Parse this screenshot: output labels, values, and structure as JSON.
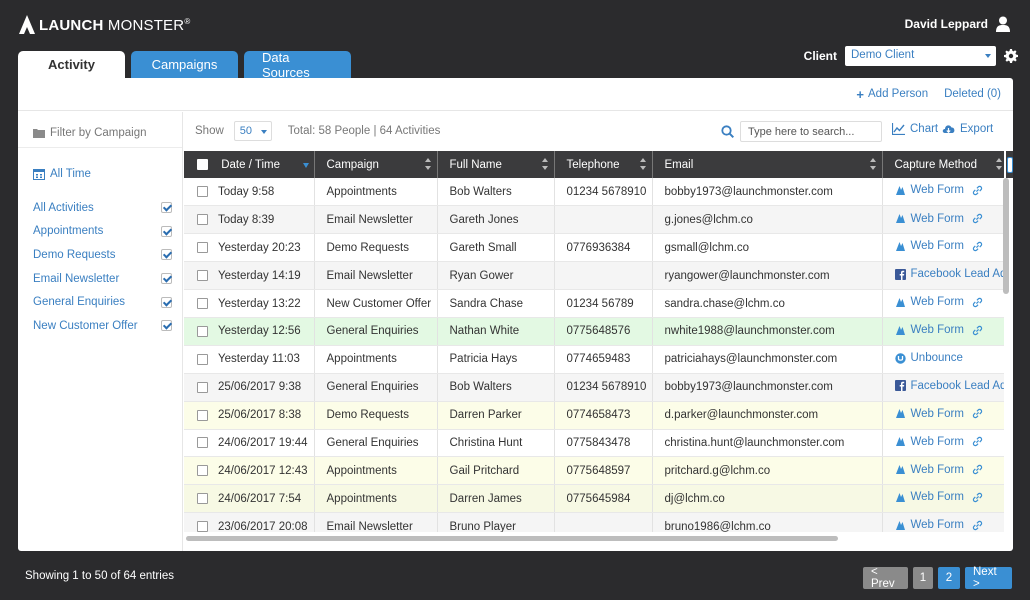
{
  "app": {
    "brand_bold": "LAUNCH",
    "brand_rest": " MONSTER",
    "trademark": "®"
  },
  "user": {
    "name": "David Leppard"
  },
  "client": {
    "label": "Client",
    "selected": "Demo Client"
  },
  "tabs": [
    {
      "label": "Activity",
      "active": true
    },
    {
      "label": "Campaigns",
      "active": false
    },
    {
      "label": "Data Sources",
      "active": false
    }
  ],
  "topbar": {
    "add_person": "Add Person",
    "deleted": "Deleted (0)"
  },
  "sidebar": {
    "filter_title": "Filter by Campaign",
    "time_filter": "All Time",
    "campaigns": [
      {
        "label": "All Activities",
        "checked": true
      },
      {
        "label": "Appointments",
        "checked": true
      },
      {
        "label": "Demo Requests",
        "checked": true
      },
      {
        "label": "Email Newsletter",
        "checked": true
      },
      {
        "label": "General Enquiries",
        "checked": true
      },
      {
        "label": "New Customer Offer",
        "checked": true
      }
    ]
  },
  "toolbar": {
    "show_label": "Show",
    "show_value": "50",
    "total": "Total: 58 People | 64 Activities",
    "search_placeholder": "Type here to search...",
    "chart": "Chart",
    "export": "Export"
  },
  "table": {
    "columns": [
      "Date / Time",
      "Campaign",
      "Full Name",
      "Telephone",
      "Email",
      "Capture Method"
    ],
    "rows": [
      {
        "date": "Today 9:58",
        "campaign": "Appointments",
        "name": "Bob Walters",
        "phone": "01234 5678910",
        "email": "bobby1973@launchmonster.com",
        "method": "Web Form",
        "method_icon": "webform",
        "style": "even"
      },
      {
        "date": "Today 8:39",
        "campaign": "Email Newsletter",
        "name": "Gareth Jones",
        "phone": "",
        "email": "g.jones@lchm.co",
        "method": "Web Form",
        "method_icon": "webform",
        "style": "odd"
      },
      {
        "date": "Yesterday 20:23",
        "campaign": "Demo Requests",
        "name": "Gareth Small",
        "phone": "0776936384",
        "email": "gsmall@lchm.co",
        "method": "Web Form",
        "method_icon": "webform",
        "style": "even"
      },
      {
        "date": "Yesterday 14:19",
        "campaign": "Email Newsletter",
        "name": "Ryan Gower",
        "phone": "",
        "email": "ryangower@launchmonster.com",
        "method": "Facebook Lead Ad",
        "method_icon": "facebook",
        "style": "odd"
      },
      {
        "date": "Yesterday 13:22",
        "campaign": "New Customer Offer",
        "name": "Sandra Chase",
        "phone": "01234 56789",
        "email": "sandra.chase@lchm.co",
        "method": "Web Form",
        "method_icon": "webform",
        "style": "even"
      },
      {
        "date": "Yesterday 12:56",
        "campaign": "General Enquiries",
        "name": "Nathan White",
        "phone": "0775648576",
        "email": "nwhite1988@launchmonster.com",
        "method": "Web Form",
        "method_icon": "webform",
        "style": "hl"
      },
      {
        "date": "Yesterday 11:03",
        "campaign": "Appointments",
        "name": "Patricia Hays",
        "phone": "0774659483",
        "email": "patriciahays@launchmonster.com",
        "method": "Unbounce",
        "method_icon": "unbounce",
        "style": "even"
      },
      {
        "date": "25/06/2017 9:38",
        "campaign": "General Enquiries",
        "name": "Bob Walters",
        "phone": "01234 5678910",
        "email": "bobby1973@launchmonster.com",
        "method": "Facebook Lead Ad",
        "method_icon": "facebook",
        "style": "odd"
      },
      {
        "date": "25/06/2017 8:38",
        "campaign": "Demo Requests",
        "name": "Darren Parker",
        "phone": "0774658473",
        "email": "d.parker@launchmonster.com",
        "method": "Web Form",
        "method_icon": "webform",
        "style": "yl"
      },
      {
        "date": "24/06/2017 19:44",
        "campaign": "General Enquiries",
        "name": "Christina Hunt",
        "phone": "0775843478",
        "email": "christina.hunt@launchmonster.com",
        "method": "Web Form",
        "method_icon": "webform",
        "style": "even"
      },
      {
        "date": "24/06/2017 12:43",
        "campaign": "Appointments",
        "name": "Gail Pritchard",
        "phone": "0775648597",
        "email": "pritchard.g@lchm.co",
        "method": "Web Form",
        "method_icon": "webform",
        "style": "yl"
      },
      {
        "date": "24/06/2017 7:54",
        "campaign": "Appointments",
        "name": "Darren James",
        "phone": "0775645984",
        "email": "dj@lchm.co",
        "method": "Web Form",
        "method_icon": "webform",
        "style": "yl"
      },
      {
        "date": "23/06/2017 20:08",
        "campaign": "Email Newsletter",
        "name": "Bruno Player",
        "phone": "",
        "email": "bruno1986@lchm.co",
        "method": "Web Form",
        "method_icon": "webform",
        "style": "odd"
      }
    ]
  },
  "footer": {
    "info": "Showing 1 to 50 of 64 entries",
    "prev": "< Prev",
    "pages": [
      "1",
      "2"
    ],
    "next": "Next >"
  },
  "colors": {
    "accent": "#3a8fd3",
    "link": "#3a7fc1",
    "header_bg": "#3b3b3d",
    "highlight_row": "#e3f9e3",
    "yellow_row": "#fcfde8"
  }
}
